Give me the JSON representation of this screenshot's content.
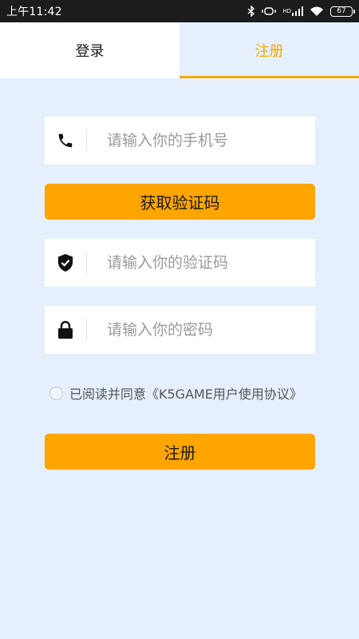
{
  "status_bar": {
    "time": "上午11:42",
    "signal_label": "HD",
    "battery_level": "67"
  },
  "tabs": {
    "login_label": "登录",
    "register_label": "注册",
    "active": "register"
  },
  "form": {
    "phone_placeholder": "请输入你的手机号",
    "get_code_label": "获取验证码",
    "code_placeholder": "请输入你的验证码",
    "password_placeholder": "请输入你的密码",
    "agreement_text": "已阅读并同意《K5GAME用户使用协议》",
    "submit_label": "注册"
  },
  "colors": {
    "accent": "#ffa500",
    "active_tab_text": "#f5a900",
    "background": "#e6f0fc"
  }
}
